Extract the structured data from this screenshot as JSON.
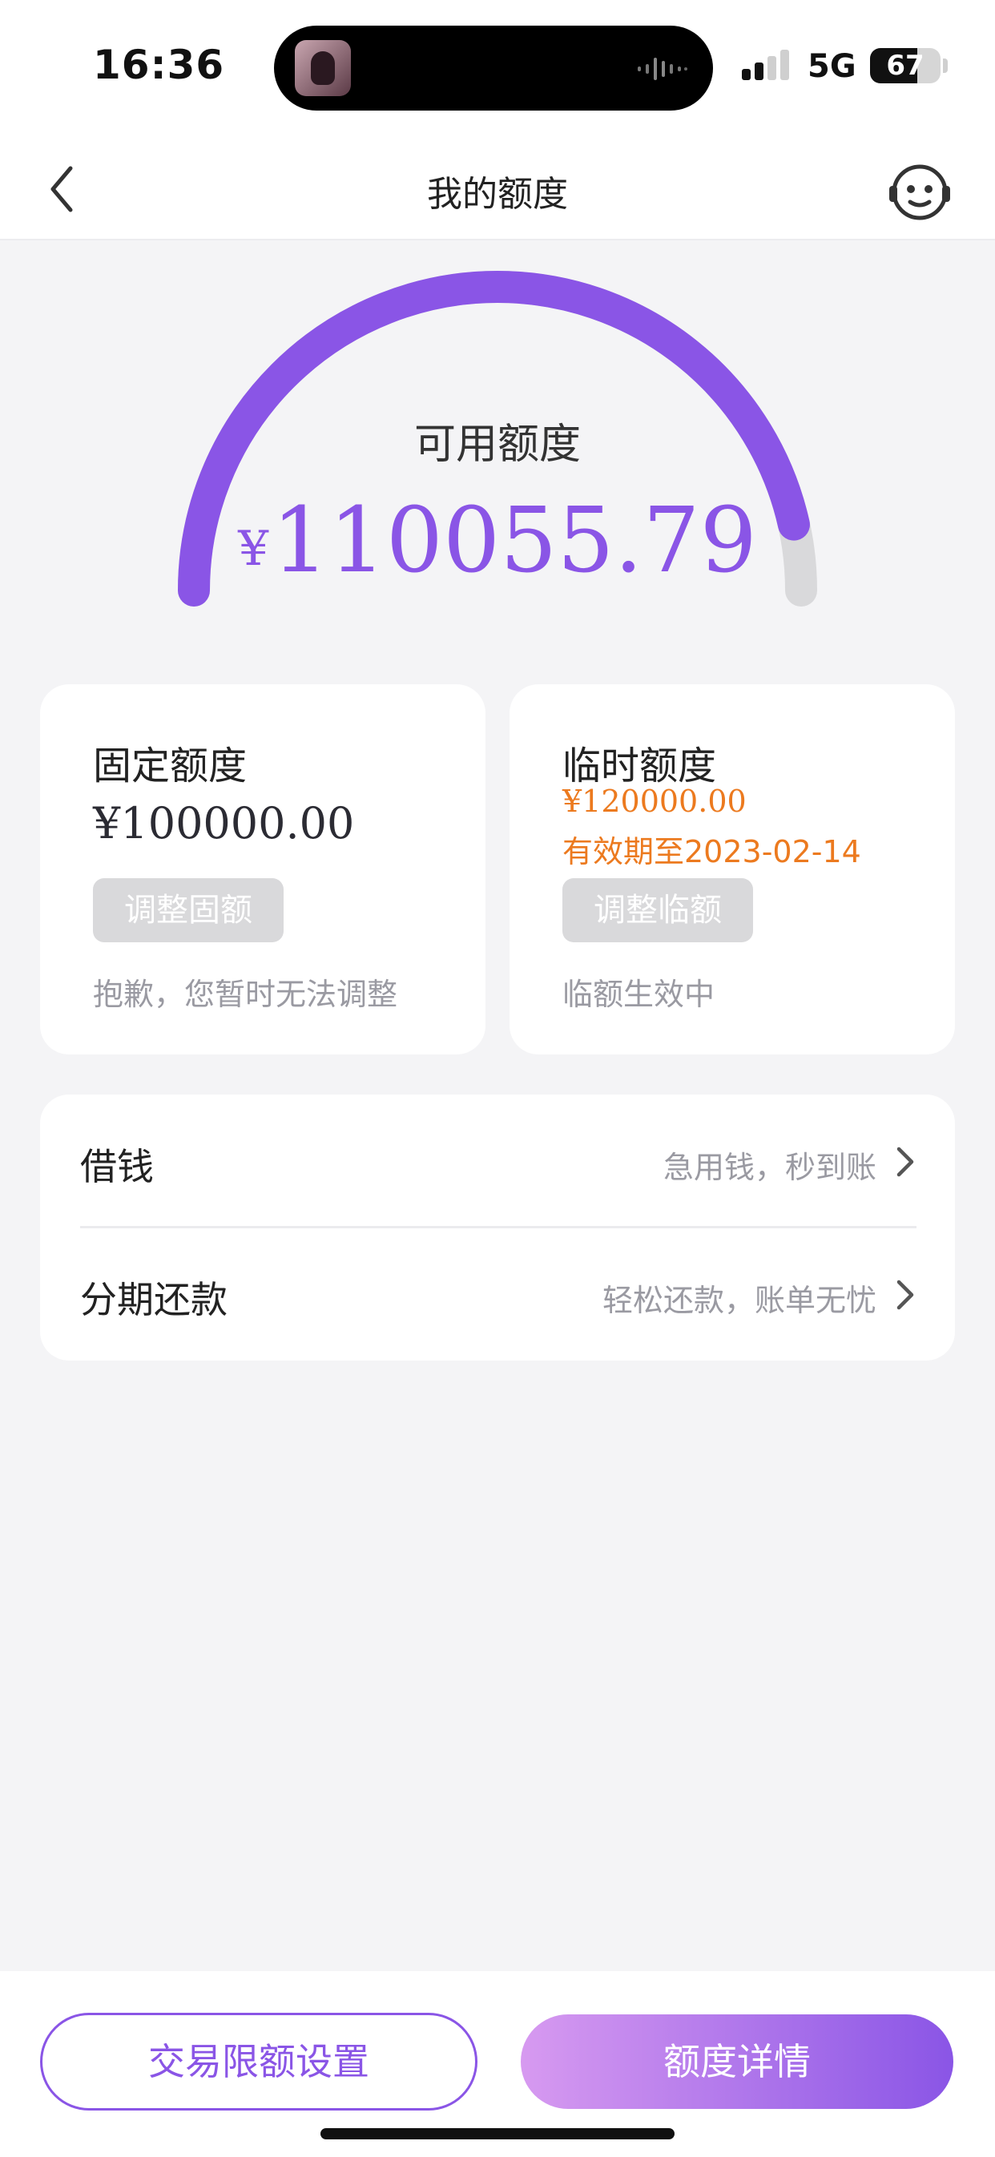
{
  "status_bar": {
    "time": "16:36",
    "network": "5G",
    "battery_level": "67",
    "battery_fraction": 0.67
  },
  "nav": {
    "title": "我的额度",
    "back_icon": "chevron-left-icon",
    "service_icon": "customer-service-icon"
  },
  "gauge": {
    "label": "可用额度",
    "currency": "¥",
    "amount": "110055.79",
    "fill_fraction": 0.93,
    "color": "#8a55e6",
    "track_color": "#d9d9db"
  },
  "fixed_card": {
    "title": "固定额度",
    "amount": "¥100000.00",
    "button_label": "调整固额",
    "note": "抱歉，您暂时无法调整"
  },
  "temp_card": {
    "title": "临时额度",
    "amount": "¥120000.00",
    "validity": "有效期至2023-02-14",
    "button_label": "调整临额",
    "note": "临额生效中"
  },
  "list": {
    "items": [
      {
        "title": "借钱",
        "subtitle": "急用钱，秒到账"
      },
      {
        "title": "分期还款",
        "subtitle": "轻松还款，账单无忧"
      }
    ]
  },
  "bottom": {
    "limit_button": "交易限额设置",
    "detail_button": "额度详情"
  },
  "colors": {
    "accent": "#8a55e6",
    "warning": "#ec7a1f"
  }
}
